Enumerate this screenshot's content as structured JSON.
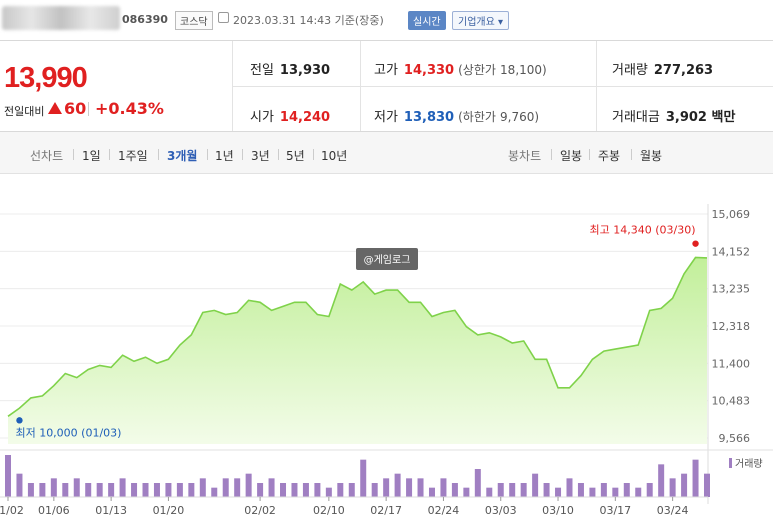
{
  "header": {
    "code": "086390",
    "market": "코스닥",
    "datetime": "2023.03.31 14:43 기준(장중)",
    "realtime_label": "실시간",
    "company_info_label": "기업개요 ▾"
  },
  "quote": {
    "price": "13,990",
    "prev_label": "전일대비",
    "change": "60",
    "change_pct": "+0.43%",
    "prev_close_label": "전일",
    "prev_close": "13,930",
    "high_label": "고가",
    "high": "14,330",
    "upper_limit_label": "(상한가",
    "upper_limit": "18,100)",
    "volume_label": "거래량",
    "volume": "277,263",
    "open_label": "시가",
    "open": "14,240",
    "low_label": "저가",
    "low": "13,830",
    "lower_limit_label": "(하한가",
    "lower_limit": "9,760)",
    "amount_label": "거래대금",
    "amount": "3,902 백만"
  },
  "tabs": {
    "line_label": "선차트",
    "periods": [
      "1일",
      "1주일",
      "3개월",
      "1년",
      "3년",
      "5년",
      "10년"
    ],
    "active_period": "3개월",
    "candle_label": "봉차트",
    "candles": [
      "일봉",
      "주봉",
      "월봉"
    ]
  },
  "colors": {
    "accent_red": "#e02020",
    "accent_blue": "#1f5fb8",
    "area_fill": "#d6f5b5",
    "line": "#7fd24a",
    "volume_bar": "#a07fc2"
  },
  "chart_data": {
    "type": "area",
    "yticks": [
      "15,069",
      "14,152",
      "13,235",
      "12,318",
      "11,400",
      "10,483",
      "9,566"
    ],
    "ylim": [
      9566,
      15069
    ],
    "xtick_labels": [
      "01/02",
      "01/06",
      "01/13",
      "01/20",
      "02/02",
      "02/10",
      "02/17",
      "02/24",
      "03/03",
      "03/10",
      "03/17",
      "03/24"
    ],
    "xtick_index": [
      0,
      4,
      9,
      14,
      22,
      28,
      33,
      38,
      43,
      48,
      53,
      58
    ],
    "x": [
      "01/02",
      "01/03",
      "01/04",
      "01/05",
      "01/06",
      "01/09",
      "01/10",
      "01/11",
      "01/12",
      "01/13",
      "01/16",
      "01/17",
      "01/18",
      "01/19",
      "01/20",
      "01/25",
      "01/26",
      "01/27",
      "01/30",
      "01/31",
      "02/01",
      "02/02",
      "02/03",
      "02/06",
      "02/07",
      "02/08",
      "02/09",
      "02/10",
      "02/13",
      "02/14",
      "02/15",
      "02/16",
      "02/17",
      "02/20",
      "02/21",
      "02/22",
      "02/23",
      "02/24",
      "02/27",
      "02/28",
      "03/02",
      "03/03",
      "03/06",
      "03/07",
      "03/08",
      "03/09",
      "03/10",
      "03/13",
      "03/14",
      "03/15",
      "03/16",
      "03/17",
      "03/20",
      "03/21",
      "03/22",
      "03/23",
      "03/24",
      "03/27",
      "03/28",
      "03/29",
      "03/30",
      "03/31"
    ],
    "values": [
      10100,
      10300,
      10550,
      10600,
      10850,
      11150,
      11050,
      11250,
      11350,
      11300,
      11600,
      11450,
      11550,
      11400,
      11500,
      11850,
      12100,
      12650,
      12700,
      12600,
      12650,
      12950,
      12900,
      12700,
      12800,
      12900,
      12900,
      12600,
      12550,
      13350,
      13200,
      13400,
      13100,
      13200,
      13200,
      12900,
      12900,
      12550,
      12650,
      12700,
      12300,
      12100,
      12150,
      12050,
      11900,
      11950,
      11500,
      11500,
      10800,
      10800,
      11100,
      11500,
      11700,
      11750,
      11800,
      11850,
      12700,
      12750,
      13000,
      13600,
      14000,
      13990
    ],
    "volume": [
      9,
      5,
      3,
      3,
      4,
      3,
      4,
      3,
      3,
      3,
      4,
      3,
      3,
      3,
      3,
      3,
      3,
      4,
      2,
      4,
      4,
      5,
      3,
      4,
      3,
      3,
      3,
      3,
      2,
      3,
      3,
      8,
      3,
      4,
      5,
      4,
      4,
      2,
      4,
      3,
      2,
      6,
      2,
      3,
      3,
      3,
      5,
      3,
      2,
      4,
      3,
      2,
      3,
      2,
      3,
      2,
      3,
      7,
      4,
      5,
      8,
      5
    ],
    "max_label": "최고 14,340 (03/30)",
    "max_index": 60,
    "max_value": 14340,
    "min_label": "최저 10,000 (01/03)",
    "min_index": 1,
    "min_value": 10000,
    "volume_label": "거래량",
    "watermark": "@게임로그"
  }
}
